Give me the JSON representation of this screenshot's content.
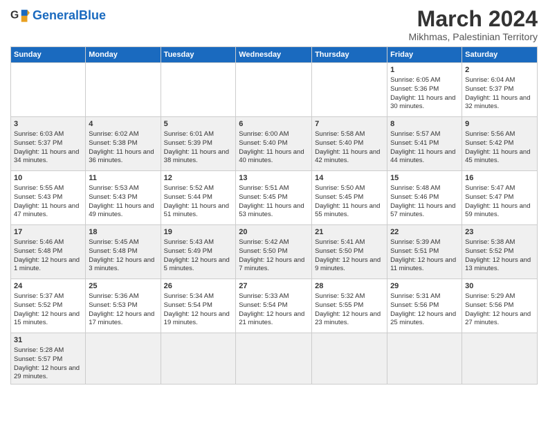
{
  "header": {
    "logo_general": "General",
    "logo_blue": "Blue",
    "title": "March 2024",
    "subtitle": "Mikhmas, Palestinian Territory"
  },
  "days_of_week": [
    "Sunday",
    "Monday",
    "Tuesday",
    "Wednesday",
    "Thursday",
    "Friday",
    "Saturday"
  ],
  "weeks": [
    [
      {
        "day": "",
        "info": ""
      },
      {
        "day": "",
        "info": ""
      },
      {
        "day": "",
        "info": ""
      },
      {
        "day": "",
        "info": ""
      },
      {
        "day": "",
        "info": ""
      },
      {
        "day": "1",
        "info": "Sunrise: 6:05 AM\nSunset: 5:36 PM\nDaylight: 11 hours and 30 minutes."
      },
      {
        "day": "2",
        "info": "Sunrise: 6:04 AM\nSunset: 5:37 PM\nDaylight: 11 hours and 32 minutes."
      }
    ],
    [
      {
        "day": "3",
        "info": "Sunrise: 6:03 AM\nSunset: 5:37 PM\nDaylight: 11 hours and 34 minutes."
      },
      {
        "day": "4",
        "info": "Sunrise: 6:02 AM\nSunset: 5:38 PM\nDaylight: 11 hours and 36 minutes."
      },
      {
        "day": "5",
        "info": "Sunrise: 6:01 AM\nSunset: 5:39 PM\nDaylight: 11 hours and 38 minutes."
      },
      {
        "day": "6",
        "info": "Sunrise: 6:00 AM\nSunset: 5:40 PM\nDaylight: 11 hours and 40 minutes."
      },
      {
        "day": "7",
        "info": "Sunrise: 5:58 AM\nSunset: 5:40 PM\nDaylight: 11 hours and 42 minutes."
      },
      {
        "day": "8",
        "info": "Sunrise: 5:57 AM\nSunset: 5:41 PM\nDaylight: 11 hours and 44 minutes."
      },
      {
        "day": "9",
        "info": "Sunrise: 5:56 AM\nSunset: 5:42 PM\nDaylight: 11 hours and 45 minutes."
      }
    ],
    [
      {
        "day": "10",
        "info": "Sunrise: 5:55 AM\nSunset: 5:43 PM\nDaylight: 11 hours and 47 minutes."
      },
      {
        "day": "11",
        "info": "Sunrise: 5:53 AM\nSunset: 5:43 PM\nDaylight: 11 hours and 49 minutes."
      },
      {
        "day": "12",
        "info": "Sunrise: 5:52 AM\nSunset: 5:44 PM\nDaylight: 11 hours and 51 minutes."
      },
      {
        "day": "13",
        "info": "Sunrise: 5:51 AM\nSunset: 5:45 PM\nDaylight: 11 hours and 53 minutes."
      },
      {
        "day": "14",
        "info": "Sunrise: 5:50 AM\nSunset: 5:45 PM\nDaylight: 11 hours and 55 minutes."
      },
      {
        "day": "15",
        "info": "Sunrise: 5:48 AM\nSunset: 5:46 PM\nDaylight: 11 hours and 57 minutes."
      },
      {
        "day": "16",
        "info": "Sunrise: 5:47 AM\nSunset: 5:47 PM\nDaylight: 11 hours and 59 minutes."
      }
    ],
    [
      {
        "day": "17",
        "info": "Sunrise: 5:46 AM\nSunset: 5:48 PM\nDaylight: 12 hours and 1 minute."
      },
      {
        "day": "18",
        "info": "Sunrise: 5:45 AM\nSunset: 5:48 PM\nDaylight: 12 hours and 3 minutes."
      },
      {
        "day": "19",
        "info": "Sunrise: 5:43 AM\nSunset: 5:49 PM\nDaylight: 12 hours and 5 minutes."
      },
      {
        "day": "20",
        "info": "Sunrise: 5:42 AM\nSunset: 5:50 PM\nDaylight: 12 hours and 7 minutes."
      },
      {
        "day": "21",
        "info": "Sunrise: 5:41 AM\nSunset: 5:50 PM\nDaylight: 12 hours and 9 minutes."
      },
      {
        "day": "22",
        "info": "Sunrise: 5:39 AM\nSunset: 5:51 PM\nDaylight: 12 hours and 11 minutes."
      },
      {
        "day": "23",
        "info": "Sunrise: 5:38 AM\nSunset: 5:52 PM\nDaylight: 12 hours and 13 minutes."
      }
    ],
    [
      {
        "day": "24",
        "info": "Sunrise: 5:37 AM\nSunset: 5:52 PM\nDaylight: 12 hours and 15 minutes."
      },
      {
        "day": "25",
        "info": "Sunrise: 5:36 AM\nSunset: 5:53 PM\nDaylight: 12 hours and 17 minutes."
      },
      {
        "day": "26",
        "info": "Sunrise: 5:34 AM\nSunset: 5:54 PM\nDaylight: 12 hours and 19 minutes."
      },
      {
        "day": "27",
        "info": "Sunrise: 5:33 AM\nSunset: 5:54 PM\nDaylight: 12 hours and 21 minutes."
      },
      {
        "day": "28",
        "info": "Sunrise: 5:32 AM\nSunset: 5:55 PM\nDaylight: 12 hours and 23 minutes."
      },
      {
        "day": "29",
        "info": "Sunrise: 5:31 AM\nSunset: 5:56 PM\nDaylight: 12 hours and 25 minutes."
      },
      {
        "day": "30",
        "info": "Sunrise: 5:29 AM\nSunset: 5:56 PM\nDaylight: 12 hours and 27 minutes."
      }
    ],
    [
      {
        "day": "31",
        "info": "Sunrise: 5:28 AM\nSunset: 5:57 PM\nDaylight: 12 hours and 29 minutes."
      },
      {
        "day": "",
        "info": ""
      },
      {
        "day": "",
        "info": ""
      },
      {
        "day": "",
        "info": ""
      },
      {
        "day": "",
        "info": ""
      },
      {
        "day": "",
        "info": ""
      },
      {
        "day": "",
        "info": ""
      }
    ]
  ]
}
